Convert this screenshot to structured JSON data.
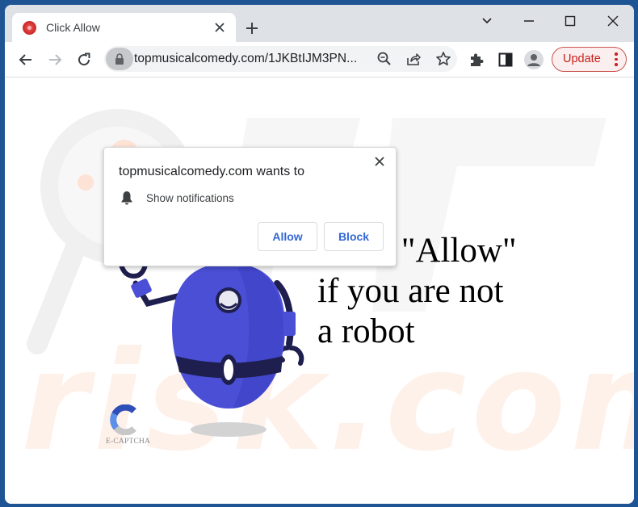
{
  "browser": {
    "tab": {
      "title": "Click Allow",
      "favicon": "red-disc-icon",
      "close_icon": "close-icon"
    },
    "new_tab_icon": "plus-icon",
    "window_controls": [
      "chevron-down-icon",
      "minimize-icon",
      "maximize-icon",
      "close-icon"
    ],
    "toolbar": {
      "back_icon": "arrow-left-icon",
      "forward_icon": "arrow-right-icon",
      "reload_icon": "reload-icon",
      "url": "topmusicalcomedy.com/1JKBtIJM3PN...",
      "omnibox_icons": [
        "zoom-out-icon",
        "share-icon",
        "star-icon"
      ],
      "extensions_icon": "puzzle-icon",
      "side_panel_icon": "side-panel-icon",
      "profile_icon": "person-icon",
      "update_label": "Update",
      "menu_icon": "kebab-icon"
    }
  },
  "permission_prompt": {
    "title": "topmusicalcomedy.com wants to",
    "permission": "Show notifications",
    "allow_label": "Allow",
    "block_label": "Block"
  },
  "page": {
    "headline_lines": [
      "Click \"Allow\"",
      "if you are not",
      "a robot"
    ],
    "captcha_label": "E-CAPTCHA"
  },
  "colors": {
    "desktop_bg": "#1f5494",
    "tabstrip_bg": "#dee1e6",
    "update_accent": "#c5221f",
    "button_text": "#3367d6",
    "robot_blue": "#4a4fd6",
    "robot_dark": "#1f1f4f",
    "watermark_orange": "#fde6d8"
  }
}
